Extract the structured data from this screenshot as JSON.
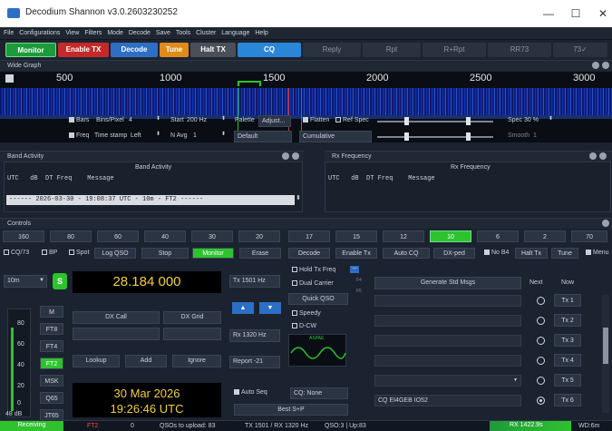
{
  "window": {
    "title": "Decodium Shannon v3.0.2603230252",
    "minimize": "—",
    "maximize": "☐",
    "close": "✕"
  },
  "menu": [
    "File",
    "Configurations",
    "View",
    "Filters",
    "Mode",
    "Decode",
    "Save",
    "Tools",
    "Cluster",
    "Language",
    "Help"
  ],
  "main_buttons": {
    "monitor": "Monitor",
    "enable_tx": "Enable TX",
    "decode": "Decode",
    "tune": "Tune",
    "halt_tx": "Halt TX",
    "cq": "CQ",
    "reply": "Reply",
    "rpt": "Rpt",
    "rrpt": "R+Rpt",
    "rr73": "RR73",
    "s73": "73✓"
  },
  "colors": {
    "monitor": "#1e9a3a",
    "enable_tx": "#c42a2a",
    "decode": "#2d6fc4",
    "tune": "#e08a1a",
    "halt_tx": "#4a4f58",
    "cq": "#2a86d6",
    "tx_active": "#2ec22e"
  },
  "wide_graph": {
    "title": "Wide Graph",
    "freq_labels": [
      "500",
      "1000",
      "1500",
      "2000",
      "2500",
      "3000"
    ],
    "bars_label": "Bars",
    "bins_label": "Bins/Pixel",
    "bins_value": "4",
    "start_label": "Start",
    "start_value": "200 Hz",
    "palette_label": "Palette",
    "adjust_label": "Adjust...",
    "flatten_label": "Flatten",
    "ref_spec_label": "Ref Spec",
    "spec_label": "Spec",
    "spec_value": "30 %",
    "freq_label": "Freq",
    "timestamp_label": "Time stamp",
    "timestamp_value": "Left",
    "navg_label": "N Avg",
    "navg_value": "1",
    "palette_value": "Default",
    "cumulative_value": "Cumulative",
    "smooth_label": "Smooth",
    "smooth_value": "1"
  },
  "band_activity": {
    "panel_title": "Band Activity",
    "header": "Band Activity",
    "columns": "UTC   dB  DT Freq    Message",
    "separator": "------ 2026-03-30 - 19:08:37 UTC - 10m - FT2 ------"
  },
  "rx_frequency": {
    "panel_title": "Rx Frequency",
    "header": "Rx Frequency",
    "columns": "UTC   dB  DT Freq    Message"
  },
  "controls": {
    "title": "Controls",
    "bands": [
      "160",
      "80",
      "60",
      "40",
      "30",
      "20",
      "17",
      "15",
      "12",
      "10",
      "6",
      "2",
      "70"
    ],
    "active_band": "10",
    "row": {
      "cq73": "CQ/73",
      "bp": "BP",
      "spot": "Spot",
      "log_qso": "Log QSO",
      "stop": "Stop",
      "monitor": "Monitor",
      "erase": "Erase",
      "decode": "Decode",
      "enable_tx": "Enable Tx",
      "auto_cq": "Auto CQ",
      "dx_ped": "DX-ped",
      "no_b4": "No B4",
      "halt_tx": "Halt Tx",
      "tune": "Tune",
      "menu": "Menu"
    },
    "band_select": "10m",
    "s_label": "S",
    "dial_freq": "28.184 000",
    "modes": [
      "M",
      "FT8",
      "FT4",
      "FT2",
      "MSK",
      "Q65",
      "JT65"
    ],
    "active_mode": "FT2",
    "meter_labels": [
      "80",
      "60",
      "40",
      "20",
      "0"
    ],
    "meter_db": "48 dB",
    "dx_call_label": "DX Call",
    "dx_grid_label": "DX Grid",
    "lookup_label": "Lookup",
    "add_label": "Add",
    "ignore_label": "Ignore",
    "date": "30 Mar 2026",
    "time": "19:26:46 UTC",
    "tx_freq": "Tx 1501 Hz",
    "rx_freq": "Rx 1320 Hz",
    "report": "Report -21",
    "hold_tx_freq": "Hold Tx Freq",
    "dual_carrier": "Dual Carrier",
    "quick_qso": "Quick QSO",
    "speedy": "Speedy",
    "dcw": "D-CW",
    "auto_seq": "Auto Seq",
    "cq_select": "CQ: None",
    "best_sp": "Best S+P",
    "astro_label": "ASPAE",
    "gen_msgs": "Generate Std Msgs",
    "next_label": "Next",
    "now_label": "Now",
    "tx_buttons": [
      "Tx 1",
      "Tx 2",
      "Tx 3",
      "Tx 4",
      "Tx 5",
      "Tx 6"
    ],
    "tx6_message": "CQ EI4GEB IO52"
  },
  "status_bar": {
    "receiving": "Receiving",
    "mode": "FT2",
    "count": "0",
    "qsos": "QSOs to upload: 83",
    "txrx": "TX 1501 / RX 1320 Hz",
    "qso_up": "QSO:3 | Up:83",
    "rx_level": "RX 1422.9s",
    "wd": "WD:6m"
  }
}
